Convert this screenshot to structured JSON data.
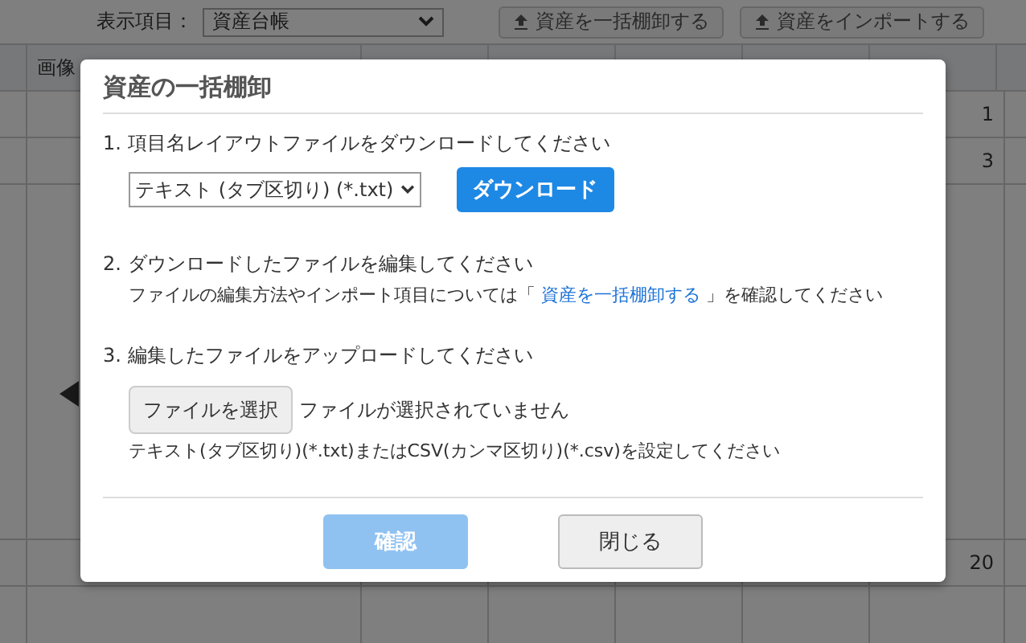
{
  "toolbar": {
    "view_label": "表示項目：",
    "view_select": "資産台帳",
    "buttons": [
      "資産を一括棚卸する",
      "資産をインポートする"
    ]
  },
  "table": {
    "columns": [
      "画像"
    ],
    "rows": [
      {
        "kind": "plain",
        "column_7": "1"
      },
      {
        "kind": "plain",
        "column_7": "3"
      },
      {
        "kind": "image"
      },
      {
        "kind": "plain",
        "column_7": "20"
      },
      {
        "kind": "empty"
      }
    ]
  },
  "dialog": {
    "title": "資産の一括棚卸",
    "step1": {
      "label": "1. 項目名レイアウトファイルをダウンロードしてください",
      "format_select": "テキスト (タブ区切り) (*.txt)",
      "download_button": "ダウンロード"
    },
    "step2": {
      "label": "2. ダウンロードしたファイルを編集してください",
      "note_before": "ファイルの編集方法やインポート項目については「",
      "note_link": "資産を一括棚卸する",
      "note_after": "」を確認してください"
    },
    "step3": {
      "label": "3. 編集したファイルをアップロードしてください",
      "file_button": "ファイルを選択",
      "file_status": "ファイルが選択されていません",
      "hint": "テキスト(タブ区切り)(*.txt)またはCSV(カンマ区切り)(*.csv)を設定してください"
    },
    "buttons": [
      {
        "label": "確認",
        "kind": "primary",
        "disabled": true
      },
      {
        "label": "閉じる",
        "kind": "secondary",
        "disabled": false
      }
    ]
  }
}
